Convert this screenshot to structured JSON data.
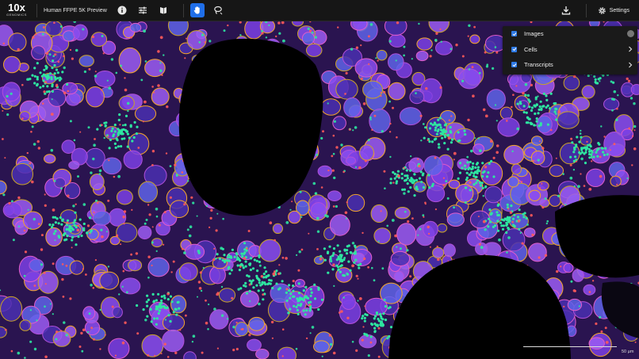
{
  "app": {
    "logo_mark": "10x",
    "logo_sub": "GENOMICS",
    "title": "Human FFPE 5K Preview"
  },
  "toolbar": {
    "tools": [
      {
        "name": "info-icon"
      },
      {
        "name": "sliders-icon"
      },
      {
        "name": "book-icon"
      },
      {
        "name": "hand-pan-icon",
        "active": true
      },
      {
        "name": "lasso-icon"
      }
    ],
    "download_icon": "download-icon",
    "settings_label": "Settings"
  },
  "layers": {
    "items": [
      {
        "label": "Images",
        "checked": true
      },
      {
        "label": "Cells",
        "checked": true
      },
      {
        "label": "Transcripts",
        "checked": true
      }
    ]
  },
  "scale": {
    "label": "50 µm"
  },
  "colors": {
    "accent": "#1f6ee8",
    "cells_purple": "#7b3fe4",
    "nuclei_blue": "#5f63e8",
    "transcripts_green": "#2ee6a0",
    "transcripts_red": "#ff5a5a",
    "outline_orange": "#f3a52a"
  }
}
